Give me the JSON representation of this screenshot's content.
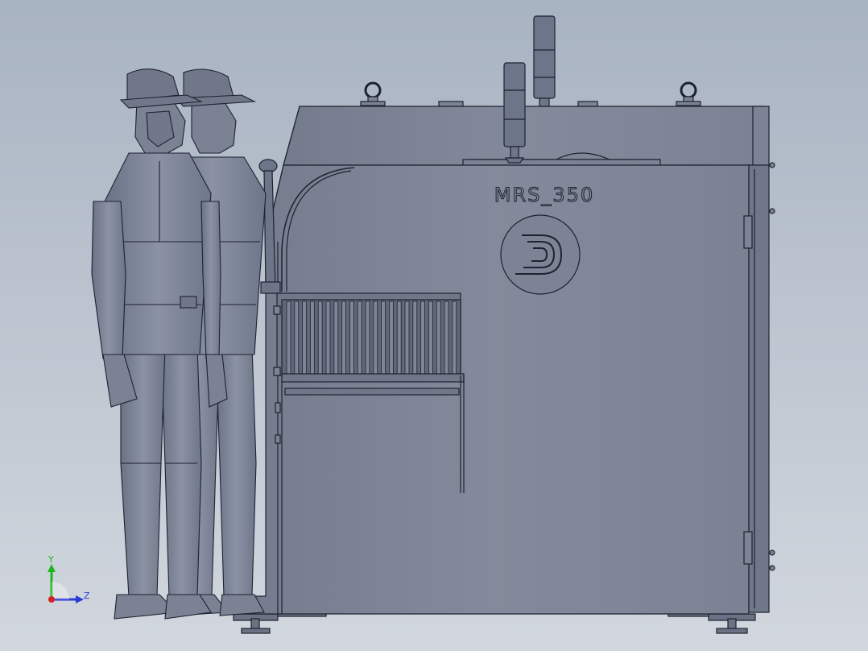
{
  "viewport": {
    "background_top": "#a8b3c2",
    "background_bottom": "#d2d7de"
  },
  "model": {
    "label": "MRS_350",
    "body_color": "#7d8597",
    "body_dark": "#5d6475",
    "line_color": "#1e2230"
  },
  "figures": [
    {
      "name": "operator-figure-front"
    },
    {
      "name": "operator-figure-back"
    }
  ],
  "triad": {
    "y_label": "Y",
    "z_label": "Z",
    "y_color": "#1fb51f",
    "z_color": "#2b3bd6",
    "x_color": "#d62222"
  }
}
